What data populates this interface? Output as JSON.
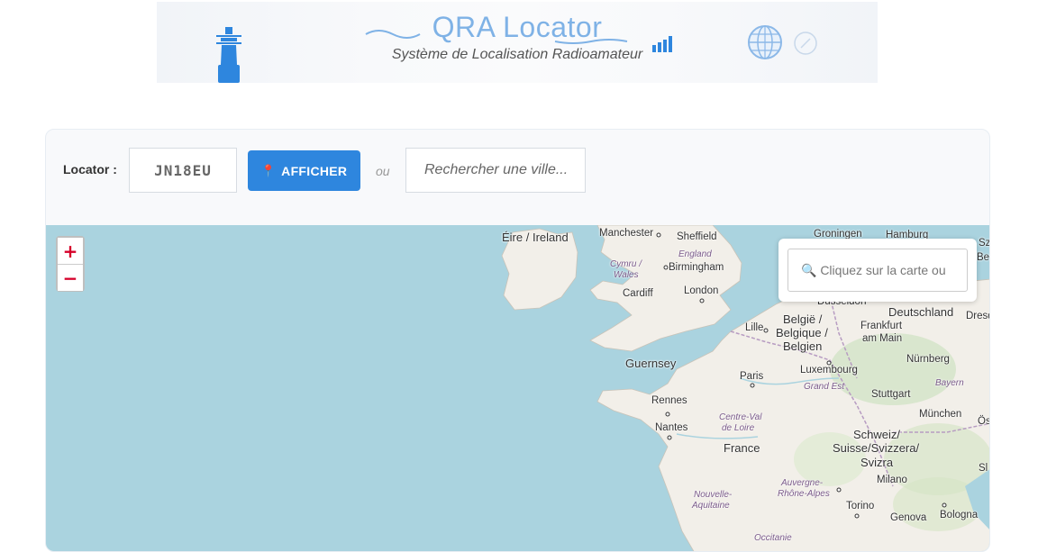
{
  "banner": {
    "title": "QRA Locator",
    "subtitle": "Système de Localisation Radioamateur",
    "icons": [
      "lighthouse-icon",
      "wave-icon",
      "signal-bars-icon",
      "globe-icon",
      "compass-icon"
    ]
  },
  "form": {
    "locator_label": "Locator :",
    "locator_value": "JN18EU",
    "show_button_label": "AFFICHER",
    "show_button_icon": "pin-icon",
    "or_text": "ou",
    "city_placeholder": "Rechercher une ville..."
  },
  "map": {
    "zoom_in": "+",
    "zoom_out": "−",
    "search_placeholder": "🔍 Cliquez sur la carte ou",
    "labels": {
      "eire": "Éire / Ireland",
      "manchester": "Manchester",
      "sheffield": "Sheffield",
      "england": "England",
      "cymru": "Cymru /",
      "wales": "Wales",
      "birmingham": "Birmingham",
      "cardiff": "Cardiff",
      "london": "London",
      "groningen": "Groningen",
      "hamburg": "Hamburg",
      "berlin_partial": "Berlin",
      "sz_partial": "Sz",
      "dusseldorf": "Düsseldorf",
      "deutschland": "Deutschland",
      "belgie": "België /",
      "belgique": "Belgique /",
      "belgien": "Belgien",
      "lille": "Lille",
      "frankfurt": "Frankfurt",
      "am_main": "am Main",
      "dresden_partial": "Dresd",
      "guernsey": "Guernsey",
      "paris": "Paris",
      "luxembourg": "Luxembourg",
      "nurnberg": "Nürnberg",
      "grand_est": "Grand Est",
      "bayern": "Bayern",
      "rennes": "Rennes",
      "stuttgart": "Stuttgart",
      "centre_val": "Centre-Val",
      "de_loire": "de Loire",
      "nantes": "Nantes",
      "munchen": "München",
      "os_partial": "Ös",
      "france": "France",
      "schweiz": "Schweiz/",
      "suisse": "Suisse/Svizzera/",
      "svizra": "Svizra",
      "auvergne": "Auvergne-",
      "rhone_alpes": "Rhône-Alpes",
      "nouvelle": "Nouvelle-",
      "aquitaine": "Aquitaine",
      "milano": "Milano",
      "torino": "Torino",
      "genova": "Genova",
      "bologna": "Bologna",
      "sl_partial": "Sl",
      "occitanie": "Occitanie"
    }
  }
}
